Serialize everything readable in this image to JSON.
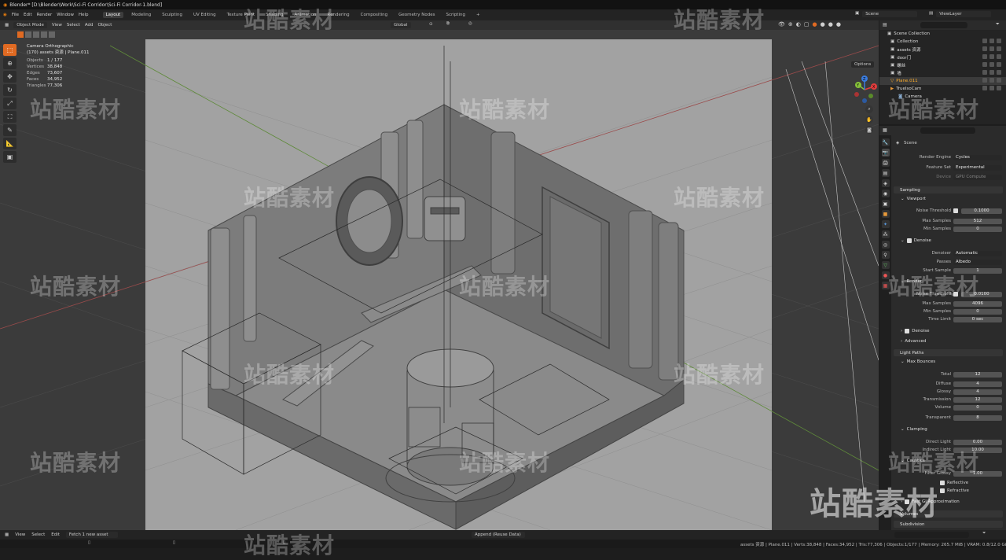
{
  "title": "Blender* [D:\\Blender\\Work\\Sci-Fi Corridor\\Sci-Fi Corridor-1.blend]",
  "menu": [
    "File",
    "Edit",
    "Render",
    "Window",
    "Help"
  ],
  "workspaces": [
    "Layout",
    "Modeling",
    "Sculpting",
    "UV Editing",
    "Texture Paint",
    "Shading",
    "Animation",
    "Rendering",
    "Compositing",
    "Geometry Nodes",
    "Scripting"
  ],
  "active_workspace": "Layout",
  "scene_name": "Scene",
  "view_layer": "ViewLayer",
  "viewport_header": {
    "mode": "Object Mode",
    "menus": [
      "View",
      "Select",
      "Add",
      "Object"
    ],
    "transform": "Global"
  },
  "options_label": "Options",
  "viewport_info": {
    "line1": "Camera Orthographic",
    "line2": "(170) assets 资源 | Plane.011",
    "stats": [
      {
        "label": "Objects",
        "value": "1 / 177"
      },
      {
        "label": "Vertices",
        "value": "38,848"
      },
      {
        "label": "Edges",
        "value": "73,607"
      },
      {
        "label": "Faces",
        "value": "34,952"
      },
      {
        "label": "Triangles",
        "value": "77,306"
      }
    ]
  },
  "gizmo": {
    "x": "X",
    "y": "Y",
    "z": "Z"
  },
  "outliner": {
    "root": "Scene Collection",
    "items": [
      "Collection",
      "assets 资源",
      "door门",
      "螺丝",
      "墙",
      "Plane.011",
      "TrueIsoCam",
      "Camera"
    ],
    "selected": "Plane.011"
  },
  "properties": {
    "context": "Scene",
    "render_engine_label": "Render Engine",
    "render_engine": "Cycles",
    "feature_set_label": "Feature Set",
    "feature_set": "Experimental",
    "device_label": "Device",
    "device": "GPU Compute",
    "sampling": "Sampling",
    "viewport": "Viewport",
    "vp_noise_label": "Noise Threshold",
    "vp_noise": "0.1000",
    "vp_max_label": "Max Samples",
    "vp_max": "512",
    "vp_min_label": "Min Samples",
    "vp_min": "0",
    "denoise": "Denoise",
    "denoiser_label": "Denoiser",
    "denoiser": "Automatic",
    "passes_label": "Passes",
    "passes": "Albedo",
    "start_sample_label": "Start Sample",
    "start_sample": "1",
    "render": "Render",
    "r_noise_label": "Noise Threshold",
    "r_noise": "0.0100",
    "r_max_label": "Max Samples",
    "r_max": "4096",
    "r_min_label": "Min Samples",
    "r_min": "0",
    "time_limit_label": "Time Limit",
    "time_limit": "0 sec",
    "denoise2": "Denoise",
    "advanced": "Advanced",
    "light_paths": "Light Paths",
    "max_bounces": "Max Bounces",
    "total_label": "Total",
    "total": "12",
    "diffuse_label": "Diffuse",
    "diffuse": "4",
    "glossy_label": "Glossy",
    "glossy": "4",
    "transmission_label": "Transmission",
    "transmission": "12",
    "volume_label": "Volume",
    "volume": "0",
    "transparent_label": "Transparent",
    "transparent": "8",
    "clamping": "Clamping",
    "direct_label": "Direct Light",
    "direct": "0.00",
    "indirect_label": "Indirect Light",
    "indirect": "10.00",
    "caustics": "Caustics",
    "filter_glossy_label": "Filter Glossy",
    "filter_glossy": "1.00",
    "reflective": "Reflective",
    "refractive": "Refractive",
    "fast_gi": "Fast GI Approximation",
    "volumes": "Volumes",
    "subdivision": "Subdivision"
  },
  "timeline": {
    "menus": [
      "View",
      "Select",
      "Edit"
    ],
    "fetch": "Fetch 1 new asset",
    "append": "Append (Reuse Data)"
  },
  "statusbar": "assets 资源 | Plane.011 | Verts:38,848 | Faces:34,952 | Tris:77,306 | Objects:1/177 | Memory: 265.7 MiB | VRAM: 0.8/12.0 GiB | 3.4.1",
  "watermark": "站酷素材",
  "colors": {
    "accent": "#e06a22",
    "selected": "#ffae2b",
    "bg": "#3b3b3b",
    "frame": "#a2a2a2"
  }
}
